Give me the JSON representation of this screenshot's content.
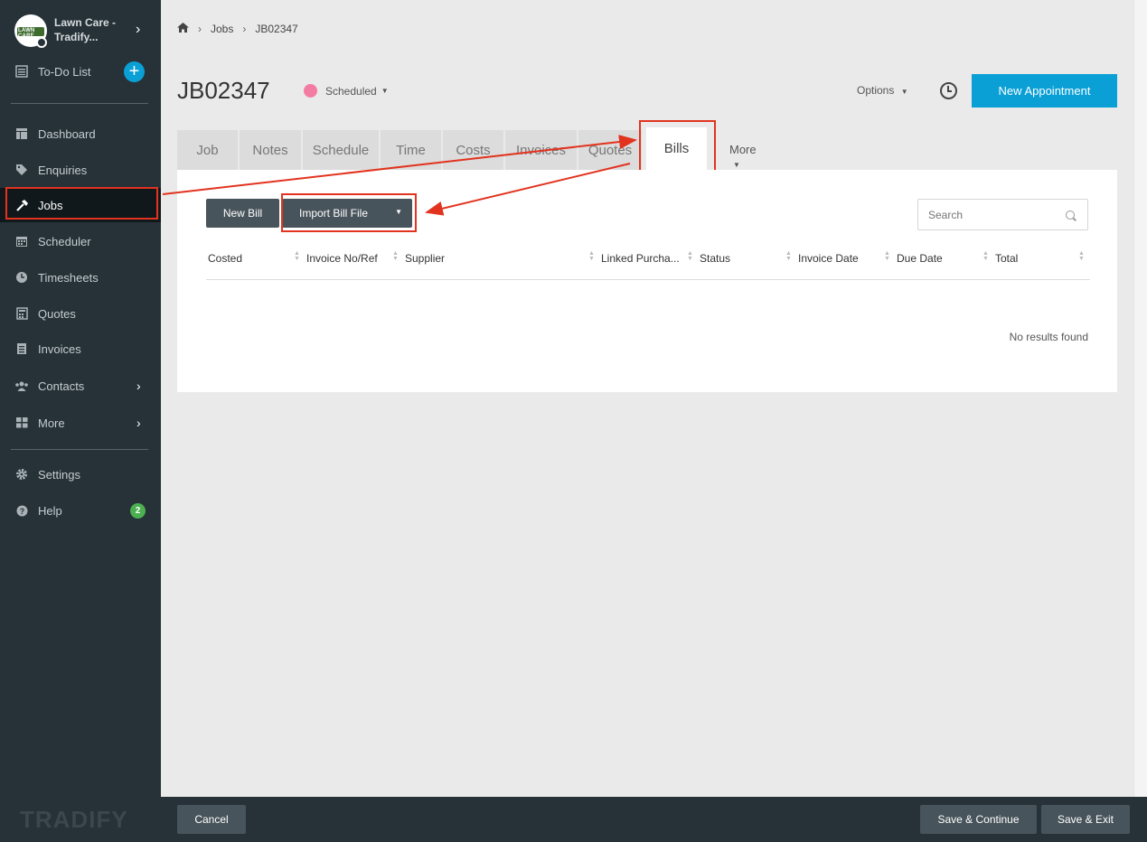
{
  "sidebar": {
    "org_name": "Lawn Care - Tradify...",
    "org_logo_text": "LAWN CARE",
    "todo_label": "To-Do List",
    "items": [
      {
        "label": "Dashboard",
        "icon": "dashboard-icon"
      },
      {
        "label": "Enquiries",
        "icon": "tags-icon"
      },
      {
        "label": "Jobs",
        "icon": "hammer-icon",
        "active": true
      },
      {
        "label": "Scheduler",
        "icon": "calendar-icon"
      },
      {
        "label": "Timesheets",
        "icon": "clock-icon"
      },
      {
        "label": "Quotes",
        "icon": "calculator-icon"
      },
      {
        "label": "Invoices",
        "icon": "document-icon"
      },
      {
        "label": "Contacts",
        "icon": "users-icon"
      },
      {
        "label": "More",
        "icon": "grid-icon"
      }
    ],
    "settings_label": "Settings",
    "help_label": "Help",
    "help_badge": "2",
    "brand": "TRADIFY"
  },
  "breadcrumb": {
    "items": [
      "Jobs",
      "JB02347"
    ]
  },
  "job": {
    "title": "JB02347",
    "status": "Scheduled",
    "status_color": "#f47ca3",
    "options_label": "Options",
    "new_appointment_label": "New Appointment"
  },
  "tabs": {
    "items": [
      "Job",
      "Notes",
      "Schedule",
      "Time",
      "Costs",
      "Invoices",
      "Quotes",
      "Bills"
    ],
    "active": "Bills",
    "more_label": "More"
  },
  "bills": {
    "new_bill_label": "New Bill",
    "import_label": "Import Bill File",
    "search_placeholder": "Search",
    "columns": [
      "Costed",
      "Invoice No/Ref",
      "Supplier",
      "Linked Purcha...",
      "Status",
      "Invoice Date",
      "Due Date",
      "Total"
    ],
    "empty_text": "No results found"
  },
  "footer": {
    "cancel_label": "Cancel",
    "save_continue_label": "Save & Continue",
    "save_exit_label": "Save & Exit"
  },
  "colors": {
    "accent": "#0aa0d6",
    "annotation": "#e2331f",
    "sidebar": "#263238"
  }
}
